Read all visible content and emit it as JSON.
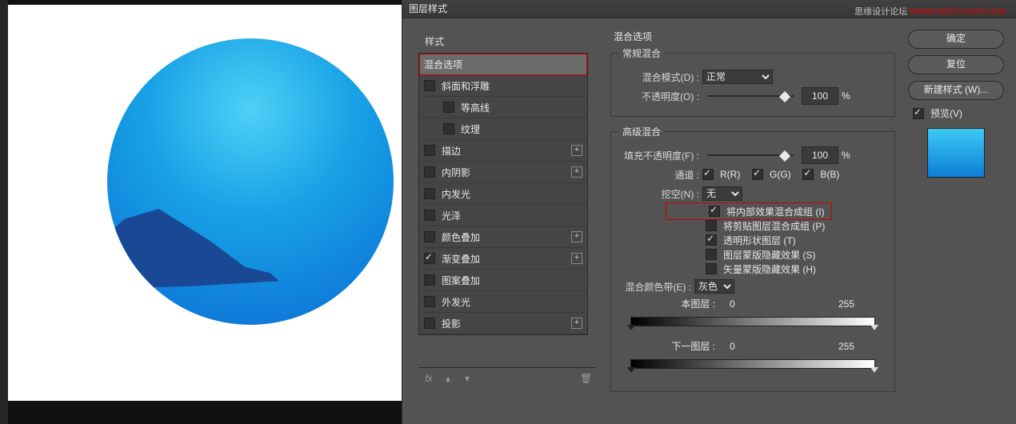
{
  "watermark": {
    "text": "思缘设计论坛",
    "url": "WWW.MISSYUAN.COM"
  },
  "dialog": {
    "title": "图层样式"
  },
  "styles": {
    "header": "样式",
    "blend_options": "混合选项",
    "bevel": "斜面和浮雕",
    "contour": "等高线",
    "texture": "纹理",
    "stroke": "描边",
    "inner_shadow": "内阴影",
    "inner_glow": "内发光",
    "satin": "光泽",
    "color_overlay": "颜色叠加",
    "gradient_overlay": "渐变叠加",
    "pattern_overlay": "图案叠加",
    "outer_glow": "外发光",
    "drop_shadow": "投影",
    "fx_label": "fx"
  },
  "options": {
    "heading": "混合选项",
    "normal_group": "常规混合",
    "blend_mode_label": "混合模式(D) :",
    "blend_mode_value": "正常",
    "opacity_label": "不透明度(O) :",
    "opacity_value": "100",
    "percent": "%",
    "advanced_group": "高级混合",
    "fill_opacity_label": "填充不透明度(F) :",
    "fill_opacity_value": "100",
    "channels_label": "通道 :",
    "channel_r": "R(R)",
    "channel_g": "G(G)",
    "channel_b": "B(B)",
    "knockout_label": "挖空(N) :",
    "knockout_value": "无",
    "blend_interior": "将内部效果混合成组 (I)",
    "blend_clipped": "将剪贴图层混合成组 (P)",
    "transparency_shapes": "透明形状图层 (T)",
    "layer_mask_hides": "图层蒙版隐藏效果 (S)",
    "vector_mask_hides": "矢量蒙版隐藏效果 (H)",
    "blend_if_label": "混合颜色带(E) :",
    "blend_if_value": "灰色",
    "this_layer": "本图层 :",
    "underlying": "下一图层 :",
    "val_0": "0",
    "val_255": "255"
  },
  "buttons": {
    "ok": "确定",
    "cancel": "复位",
    "new_style": "新建样式 (W)...",
    "preview": "预览(V)"
  }
}
